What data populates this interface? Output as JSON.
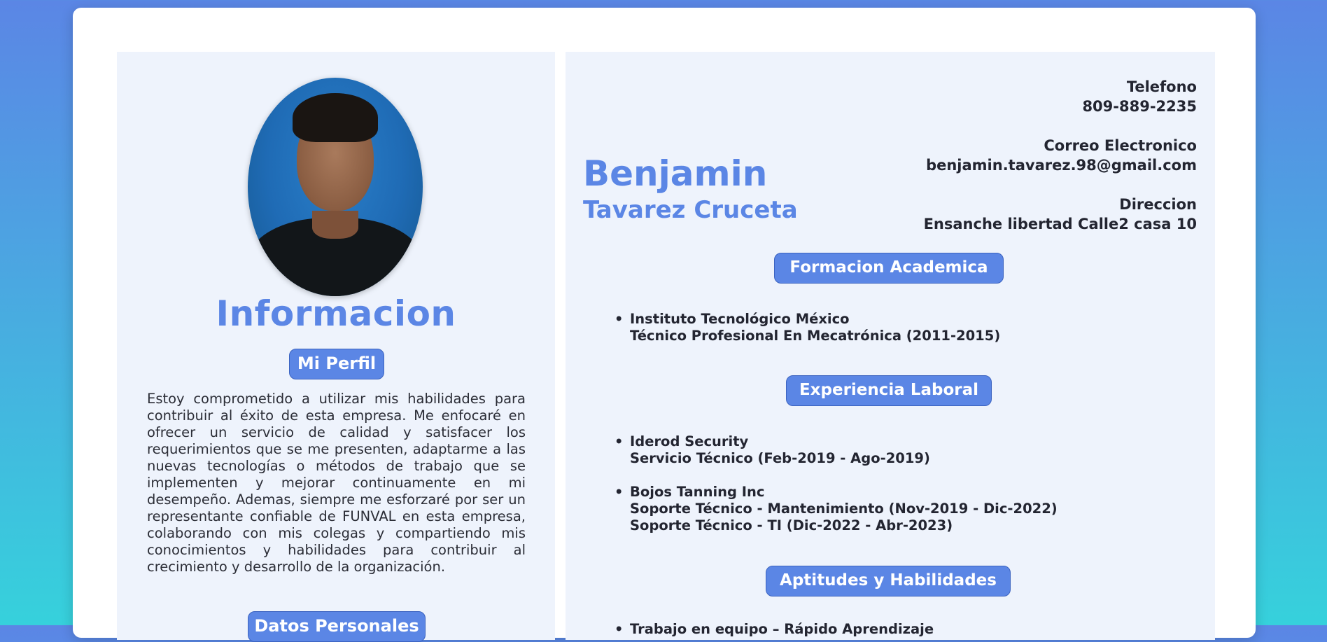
{
  "profile": {
    "info_title": "Informacion",
    "perfil_label": "Mi Perfil",
    "description": "Estoy comprometido a utilizar mis habilidades para contribuir al éxito de esta empresa. Me enfocaré en ofrecer un servicio de calidad y satisfacer los requerimientos que se me presenten, adaptarme a las nuevas tecnologías o métodos de trabajo que se implementen y mejorar continuamente en mi desempeño. Ademas, siempre me esforzaré por ser un representante confiable de FUNVAL en esta empresa, colaborando con mis colegas y compartiendo mis conocimientos y habilidades para contribuir al crecimiento y desarrollo de la organización.",
    "datos_label": "Datos Personales"
  },
  "name": {
    "first": "Benjamin",
    "last": "Tavarez Cruceta"
  },
  "contact": {
    "phone_label": "Telefono",
    "phone": "809-889-2235",
    "email_label": "Correo Electronico",
    "email": "benjamin.tavarez.98@gmail.com",
    "address_label": "Direccion",
    "address": "Ensanche libertad Calle2 casa 10"
  },
  "sections": {
    "formacion": "Formacion Academica",
    "experiencia": "Experiencia Laboral",
    "aptitudes": "Aptitudes y Habilidades"
  },
  "education": [
    {
      "line1": "Instituto Tecnológico México",
      "line2": "Técnico Profesional En Mecatrónica (2011-2015)"
    }
  ],
  "experience": [
    {
      "line1": "Iderod Security",
      "line2": "Servicio Técnico (Feb-2019 - Ago-2019)"
    },
    {
      "line1": "Bojos Tanning Inc",
      "line2": "Soporte Técnico - Mantenimiento (Nov-2019 - Dic-2022)",
      "line3": "Soporte Técnico - TI (Dic-2022 - Abr-2023)"
    }
  ],
  "skills": [
    "Trabajo en equipo – Rápido Aprendizaje"
  ],
  "bullet": "•",
  "colors": {
    "accent": "#5b86e5",
    "panel": "#eef3fc",
    "text": "#232531"
  }
}
